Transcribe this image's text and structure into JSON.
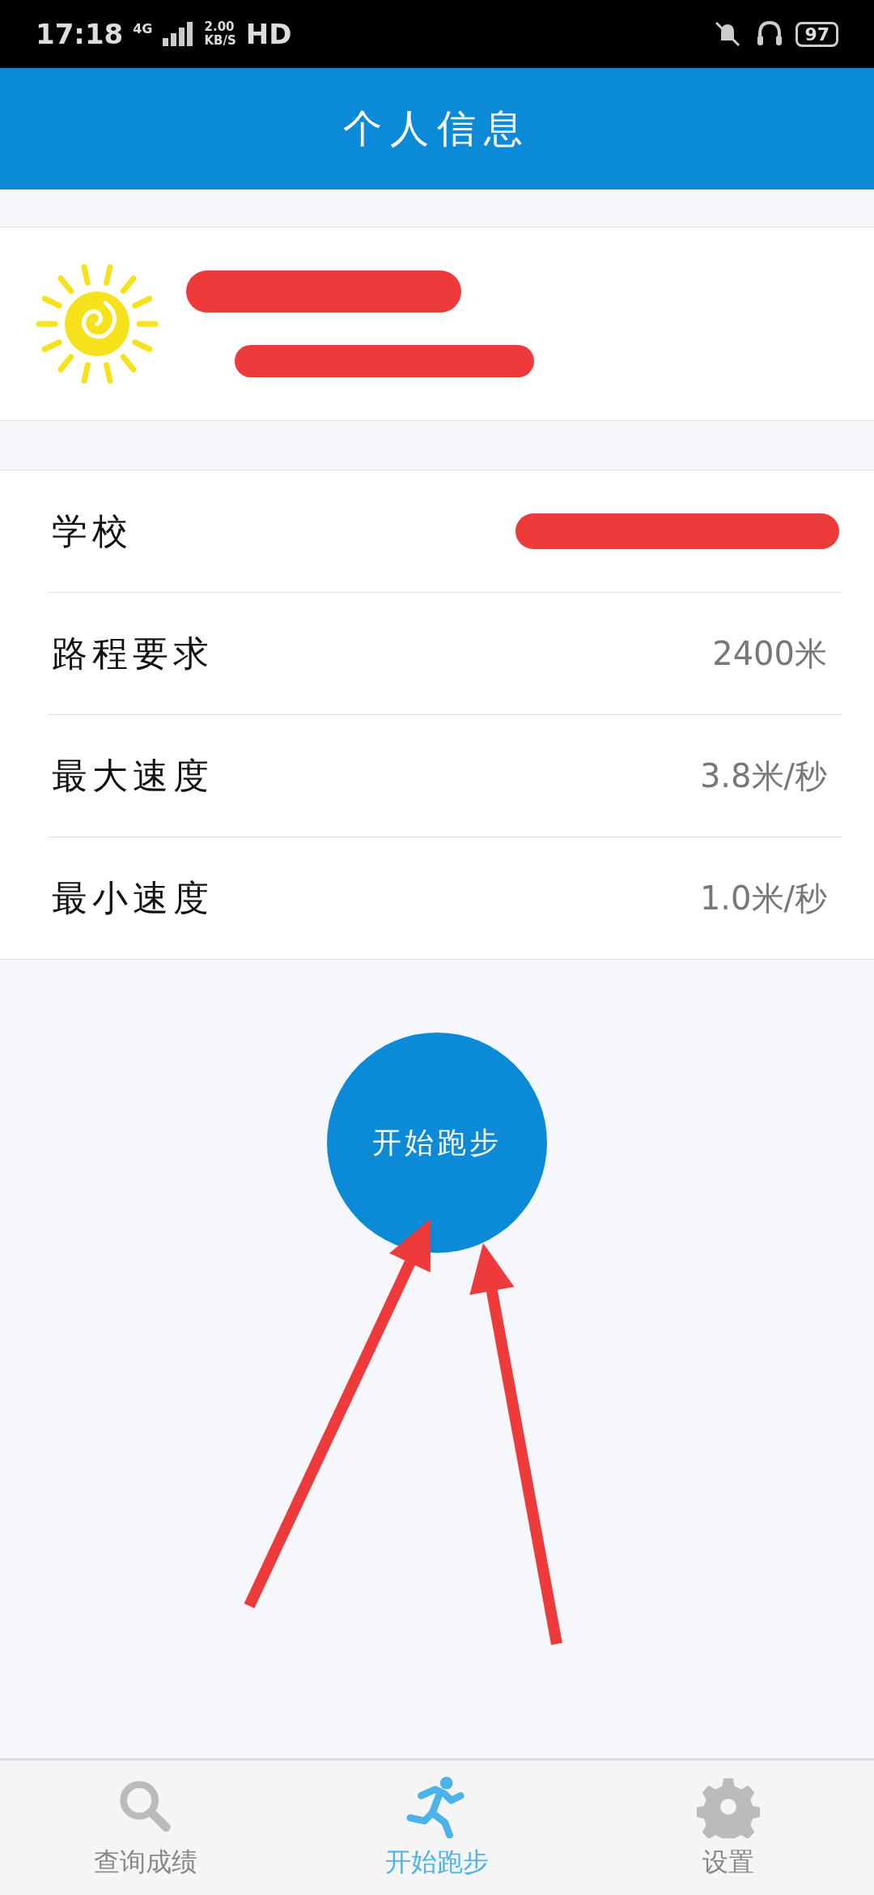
{
  "status_bar": {
    "time": "17:18",
    "network": "4G",
    "speed_value": "2.00",
    "speed_unit": "KB/S",
    "hd": "HD",
    "battery": "97"
  },
  "header": {
    "title": "个人信息"
  },
  "profile": {
    "redacted": true
  },
  "info_rows": [
    {
      "label": "学校",
      "redacted": true
    },
    {
      "label": "路程要求",
      "value": "2400米",
      "redacted": false
    },
    {
      "label": "最大速度",
      "value": "3.8米/秒",
      "redacted": false
    },
    {
      "label": "最小速度",
      "value": "1.0米/秒",
      "redacted": false
    }
  ],
  "start_button": {
    "label": "开始跑步"
  },
  "annotations": [
    {
      "kind": "arrow"
    },
    {
      "kind": "arrow"
    }
  ],
  "tabs": [
    {
      "label": "查询成绩",
      "kind": "search",
      "selected": false
    },
    {
      "label": "开始跑步",
      "kind": "run",
      "selected": true
    },
    {
      "label": "设置",
      "kind": "settings",
      "selected": false
    }
  ]
}
